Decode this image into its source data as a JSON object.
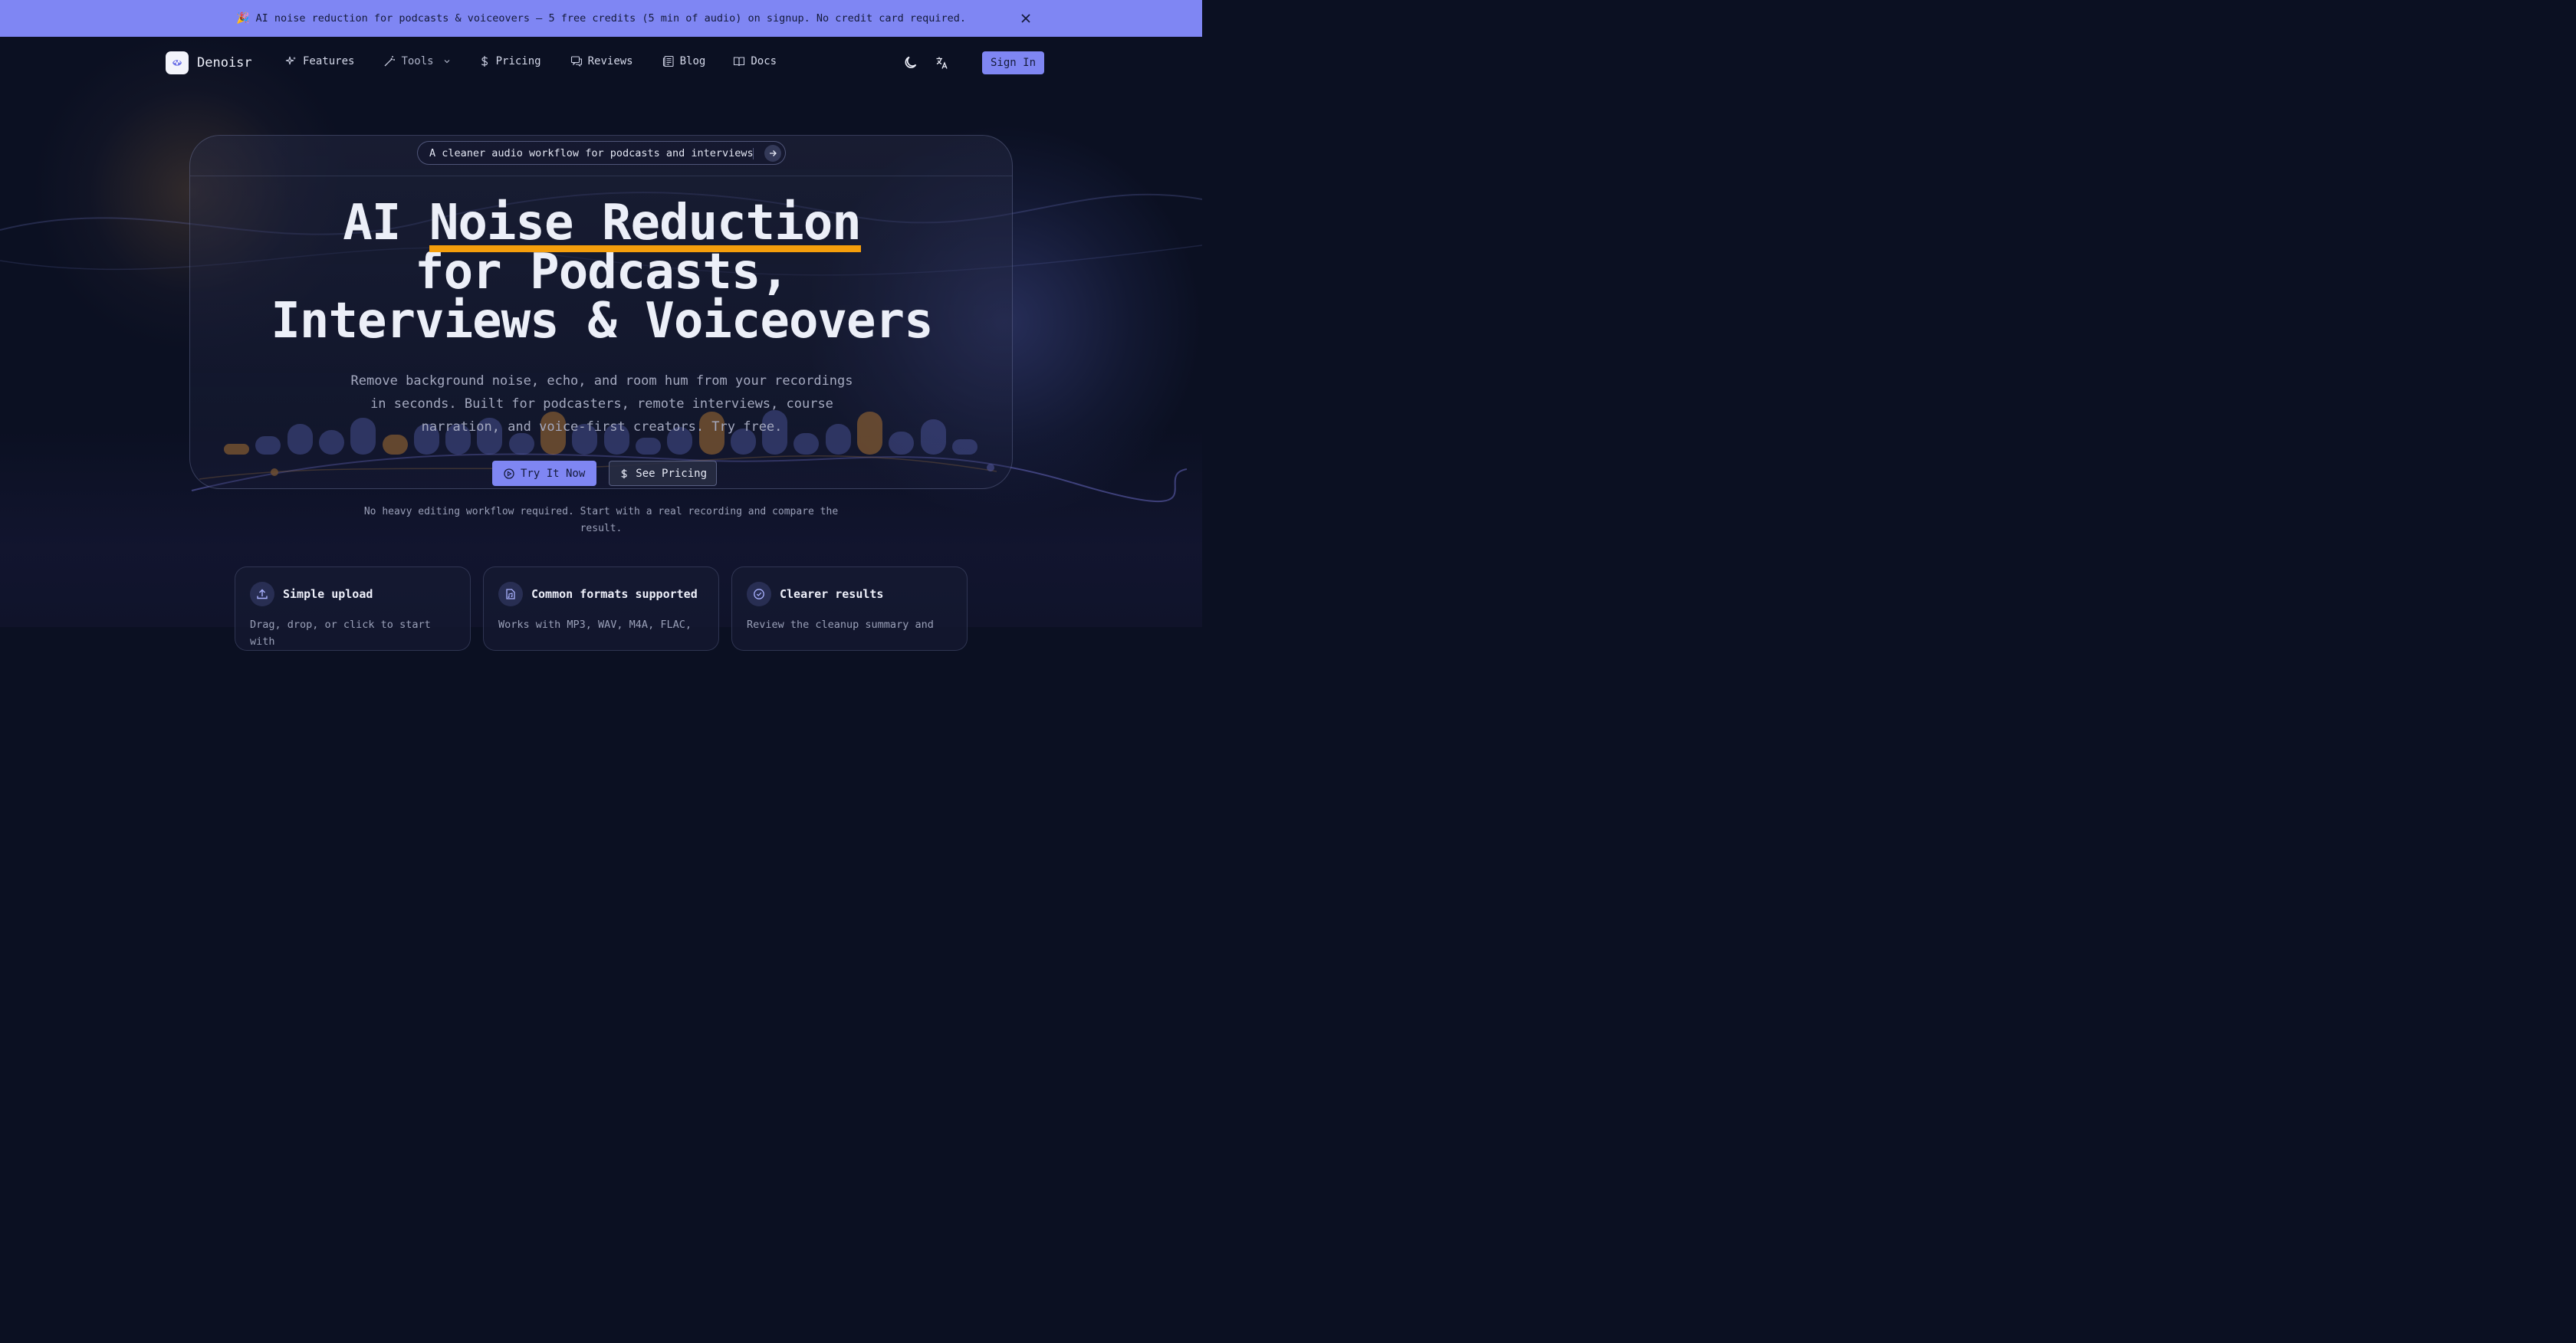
{
  "banner": {
    "emoji": "🎉",
    "text": "AI noise reduction for podcasts & voiceovers — 5 free credits (5 min of audio) on signup. No credit card required."
  },
  "nav": {
    "brand": "Denoisr",
    "links": [
      {
        "label": "Features",
        "icon": "sparkles-icon"
      },
      {
        "label": "Tools",
        "icon": "wand-icon"
      },
      {
        "label": "Pricing",
        "icon": "dollar-icon"
      },
      {
        "label": "Reviews",
        "icon": "chat-icon"
      },
      {
        "label": "Blog",
        "icon": "newspaper-icon"
      },
      {
        "label": "Docs",
        "icon": "book-icon"
      }
    ],
    "sign_in": "Sign In"
  },
  "hero": {
    "pill": "A cleaner audio workflow for podcasts and interviews",
    "headline": {
      "prefix": "AI ",
      "highlight": "Noise Reduction",
      "line2": "for Podcasts,",
      "line3": "Interviews & Voiceovers"
    },
    "subtext": "Remove background noise, echo, and room hum from your recordings in seconds. Built for podcasters, remote interviews, course narration, and voice-first creators. Try free.",
    "cta_primary": "Try It Now",
    "cta_secondary": "See Pricing"
  },
  "note": "No heavy editing workflow required. Start with a real recording and compare the result.",
  "features": [
    {
      "title": "Simple upload",
      "desc": "Drag, drop, or click to start with",
      "icon": "upload-icon"
    },
    {
      "title": "Common formats supported",
      "desc": "Works with MP3, WAV, M4A, FLAC,",
      "icon": "audio-file-icon"
    },
    {
      "title": "Clearer results",
      "desc": "Review the cleanup summary and",
      "icon": "check-circle-icon"
    }
  ],
  "colors": {
    "accent": "#7f86f3",
    "highlight": "#f59e0b",
    "background": "#0b1022"
  }
}
